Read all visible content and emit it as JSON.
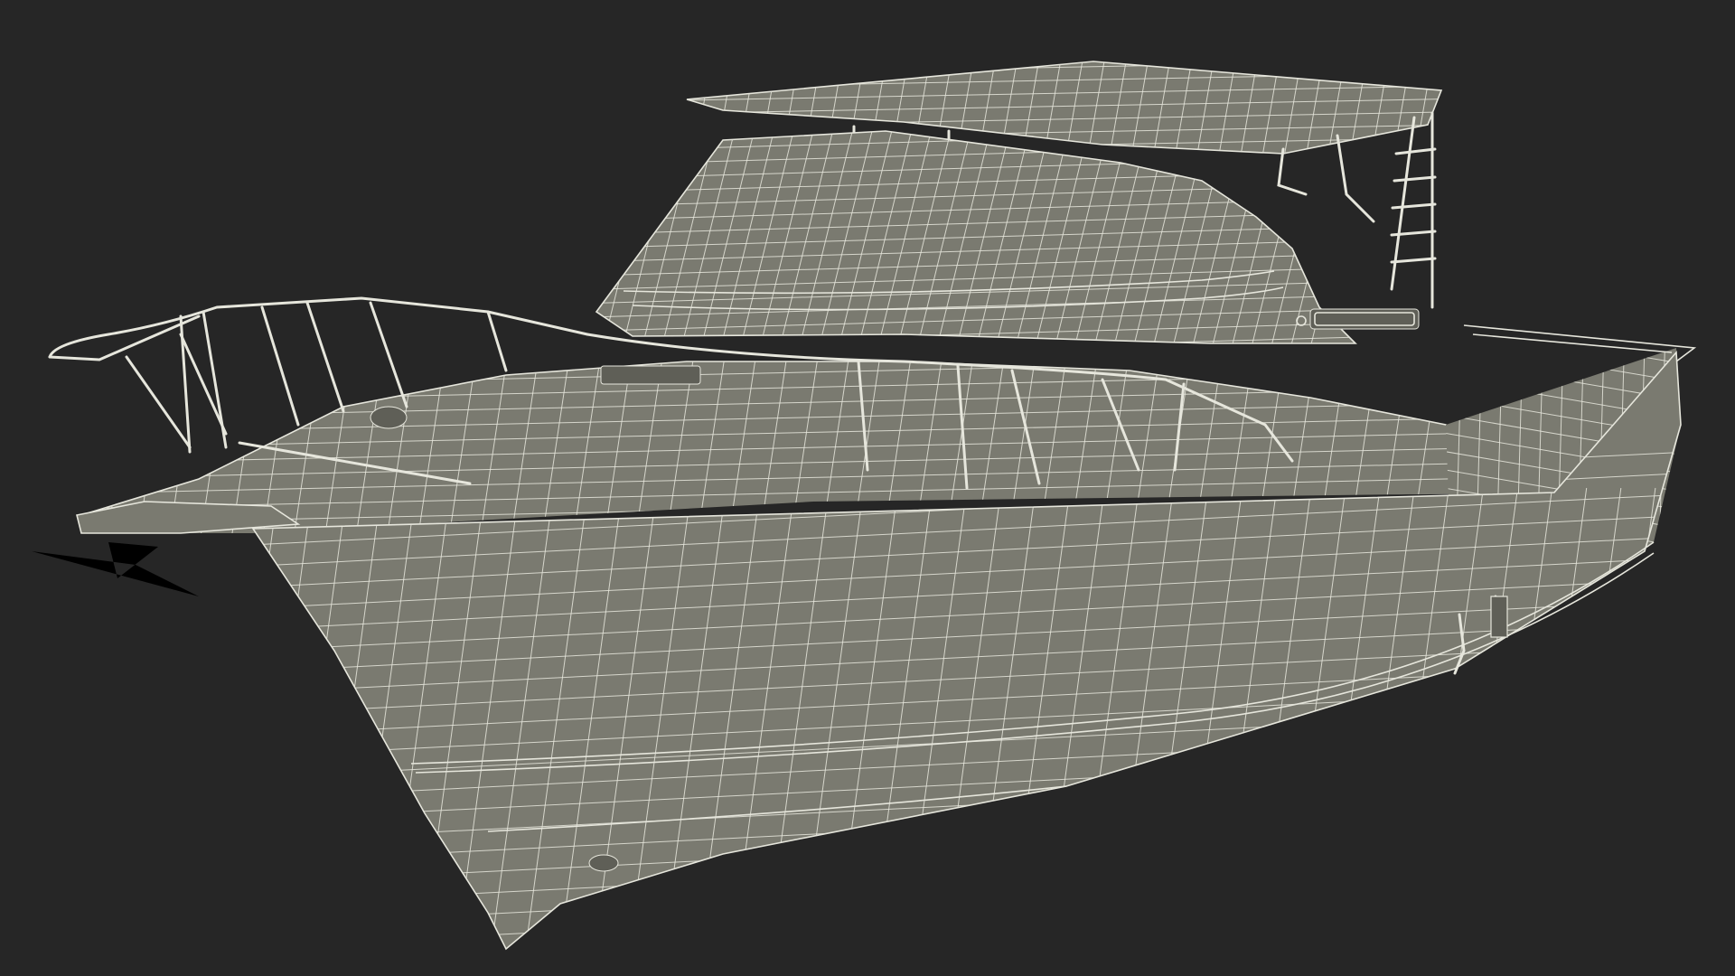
{
  "scene": {
    "background_color": "#262626",
    "surface_color": "#7a7a70",
    "surface_shadow_color": "#5f5f57",
    "surface_light_color": "#8a8a80",
    "wire_color": "#e6e6dc"
  }
}
